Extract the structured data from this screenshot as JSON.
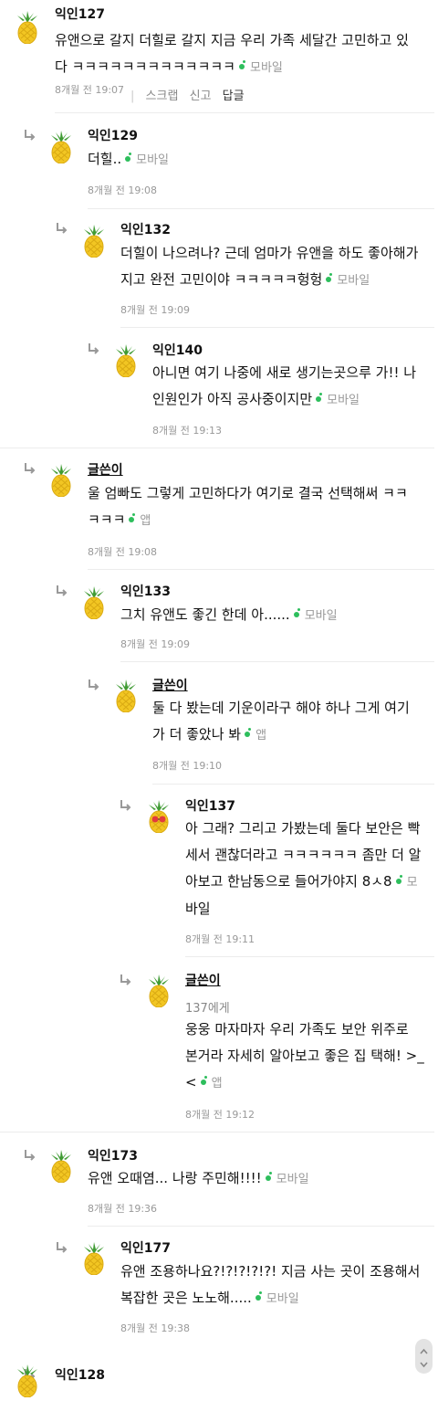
{
  "comments": [
    {
      "name": "익인127",
      "writer": false,
      "to": "",
      "lines": [
        "유앤으로 갈지 더힐로 갈지 지금 우리 가족 세달간 고민하고 있",
        "다 ㅋㅋㅋㅋㅋㅋㅋㅋㅋㅋㅋㅋㅋ"
      ],
      "device": "모바일",
      "time": "8개월 전 19:07",
      "links": {
        "scrap": "스크랩",
        "report": "신고",
        "reply": "답글"
      }
    },
    {
      "name": "익인129",
      "writer": false,
      "to": "",
      "lines": [
        "더힐.."
      ],
      "device": "모바일",
      "time": "8개월 전 19:08"
    },
    {
      "name": "익인132",
      "writer": false,
      "to": "",
      "lines": [
        "더힐이 나으려나? 근데 엄마가 유앤을 하도 좋아해가",
        "지고 완전 고민이야 ㅋㅋㅋㅋㅋ헝헝"
      ],
      "device": "모바일",
      "time": "8개월 전 19:09"
    },
    {
      "name": "익인140",
      "writer": false,
      "to": "",
      "lines": [
        "아니면 여기 나중에 새로 생기는곳으루 가!! 나",
        "인원인가 아직 공사중이지만"
      ],
      "device": "모바일",
      "time": "8개월 전 19:13"
    },
    {
      "name": "글쓴이",
      "writer": true,
      "to": "",
      "lines": [
        "울 엄빠도 그렇게 고민하다가 여기로 결국 선택해써 ㅋㅋ",
        "ㅋㅋㅋ"
      ],
      "device": "앱",
      "time": "8개월 전 19:08"
    },
    {
      "name": "익인133",
      "writer": false,
      "to": "",
      "lines": [
        "그치 유앤도 좋긴 한데 아......"
      ],
      "device": "모바일",
      "time": "8개월 전 19:09"
    },
    {
      "name": "글쓴이",
      "writer": true,
      "to": "",
      "lines": [
        "둘 다 봤는데 기운이라구 해야 하나 그게 여기",
        "가 더 좋았나 봐"
      ],
      "device": "앱",
      "time": "8개월 전 19:10"
    },
    {
      "name": "익인137",
      "writer": false,
      "to": "",
      "lines": [
        "아 그래? 그리고 가봤는데 둘다 보안은 빡",
        "세서 괜찮더라고 ㅋㅋㅋㅋㅋㅋ 좀만 더 알",
        "아보고 한남동으로 들어가야지 8ㅅ8",
        "바일"
      ],
      "device": "모",
      "time": "8개월 전 19:11"
    },
    {
      "name": "글쓴이",
      "writer": true,
      "to": "137에게",
      "lines": [
        "웅웅 마자마자 우리 가족도 보안 위주로",
        "본거라 자세히 알아보고 좋은 집 택해! >_",
        "<"
      ],
      "device": "앱",
      "time": "8개월 전 19:12"
    },
    {
      "name": "익인173",
      "writer": false,
      "to": "",
      "lines": [
        "유앤 오때염... 나랑 주민해!!!!"
      ],
      "device": "모바일",
      "time": "8개월 전 19:36"
    },
    {
      "name": "익인177",
      "writer": false,
      "to": "",
      "lines": [
        "유앤 조용하나요?!?!?!?!?! 지금 사는 곳이 조용해서",
        "복잡한 곳은 노노해....."
      ],
      "device": "모바일",
      "time": "8개월 전 19:38"
    },
    {
      "name": "익인128",
      "writer": false,
      "to": "",
      "lines": [],
      "device": "",
      "time": ""
    }
  ],
  "colors": {
    "accent": "#2dbe5c",
    "pineapple": "#f2c623",
    "leaf": "#3f9b33"
  }
}
